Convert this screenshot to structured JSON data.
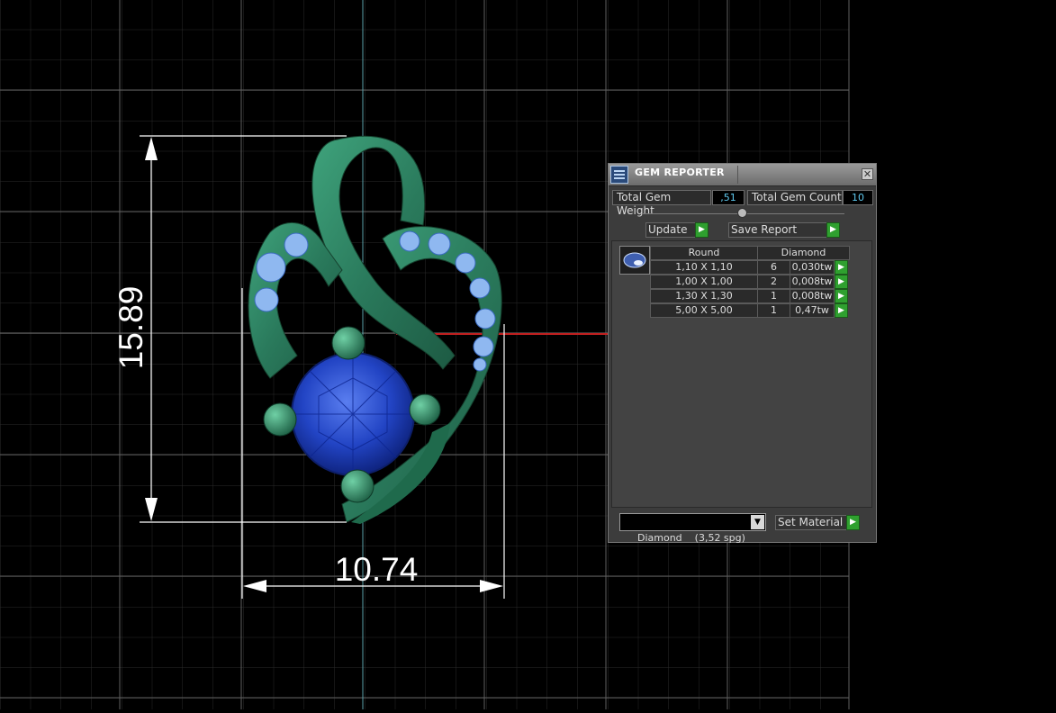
{
  "dimensions": {
    "height": "15.89",
    "width": "10.74"
  },
  "panel": {
    "title": "GEM REPORTER",
    "close_glyph": "✕",
    "total_weight_label": "Total Gem Weight",
    "total_weight_value": ",51",
    "total_count_label": "Total Gem Count",
    "total_count_value": "10",
    "update_label": "Update",
    "save_report_label": "Save Report",
    "table": {
      "headers": [
        "Round",
        "Diamond"
      ],
      "rows": [
        {
          "size": "1,10 X 1,10",
          "count": "6",
          "weight": "0,030tw"
        },
        {
          "size": "1,00 X 1,00",
          "count": "2",
          "weight": "0,008tw"
        },
        {
          "size": "1,30 X 1,30",
          "count": "1",
          "weight": "0,008tw"
        },
        {
          "size": "5,00 X 5,00",
          "count": "1",
          "weight": "0,47tw"
        }
      ]
    },
    "material_select_value": "Diamond    (3,52 spg)",
    "set_material_label": "Set Material",
    "play_glyph": "▶",
    "dropdown_glyph": "▼"
  },
  "colors": {
    "metal": "#2f8766",
    "stone": "#1a3fb5",
    "accent_stones": "#8fb8f0",
    "dimension_lines": "#ffffff",
    "play_button": "#2fa02f",
    "value_text": "#5ec8ee"
  }
}
